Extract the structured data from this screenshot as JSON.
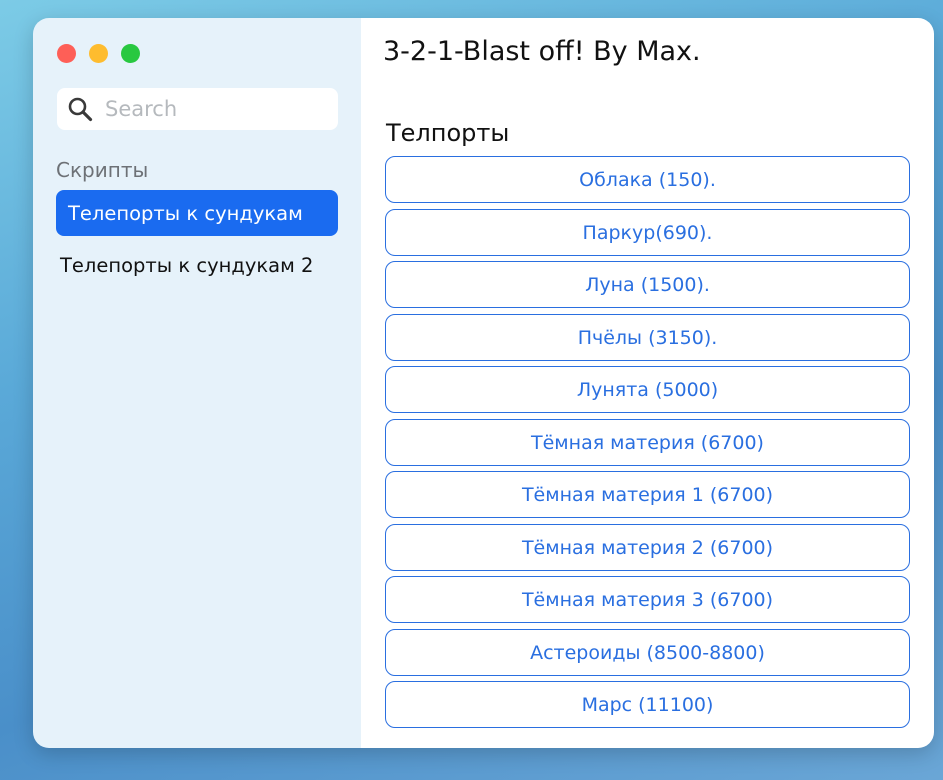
{
  "window": {
    "controls": [
      {
        "name": "close",
        "color": "#fe5f57"
      },
      {
        "name": "minimize",
        "color": "#febc2e"
      },
      {
        "name": "zoom",
        "color": "#28c840"
      }
    ]
  },
  "sidebar": {
    "search": {
      "placeholder": "Search",
      "value": ""
    },
    "section_label": "Скрипты",
    "items": [
      {
        "label": "Телепорты к сундукам",
        "active": true
      },
      {
        "label": "Телепорты к сундукам 2",
        "active": false
      }
    ]
  },
  "main": {
    "title": "3-2-1-Blast off! By Max.",
    "group_title": "Телпорты",
    "buttons": [
      {
        "label": "Облака (150)."
      },
      {
        "label": "Паркур(690)."
      },
      {
        "label": "Луна (1500)."
      },
      {
        "label": "Пчёлы (3150)."
      },
      {
        "label": "Лунята (5000)"
      },
      {
        "label": "Тёмная материя (6700)"
      },
      {
        "label": "Тёмная материя 1 (6700)"
      },
      {
        "label": "Тёмная материя 2 (6700)"
      },
      {
        "label": "Тёмная материя 3 (6700)"
      },
      {
        "label": "Астероиды (8500-8800)"
      },
      {
        "label": "Марс (11100)"
      }
    ]
  },
  "colors": {
    "accent": "#1a6bf0",
    "button_text": "#2a6fe0",
    "sidebar_bg": "#e6f2fa"
  }
}
